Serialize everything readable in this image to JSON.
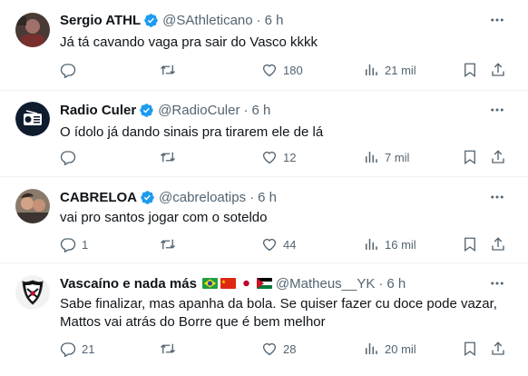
{
  "tweets": [
    {
      "name": "Sergio ATHL",
      "handle": "@SAthleticano",
      "time": "6 h",
      "text": "Já tá cavando vaga pra sair do Vasco kkkk",
      "replies": "",
      "retweets": "",
      "likes": "180",
      "views": "21 mil",
      "avatar_icon": "photo-avatar"
    },
    {
      "name": "Radio Culer",
      "handle": "@RadioCuler",
      "time": "6 h",
      "text": "O ídolo já dando sinais pra tirarem ele de lá",
      "replies": "",
      "retweets": "",
      "likes": "12",
      "views": "7 mil",
      "avatar_icon": "radio-icon"
    },
    {
      "name": "CABRELOA",
      "handle": "@cabreloatips",
      "time": "6 h",
      "text": "vai pro santos jogar com o soteldo",
      "replies": "1",
      "retweets": "",
      "likes": "44",
      "views": "16 mil",
      "avatar_icon": "photo-avatar"
    },
    {
      "name": "Vascaíno e nada más",
      "handle": "@Matheus__YK",
      "time": "6 h",
      "text_line1": "Sabe finalizar, mas apanha da bola. Se quiser fazer cu doce pode vazar,",
      "text_line2": "Mattos vai atrás do Borre que é bem melhor",
      "replies": "21",
      "retweets": "",
      "likes": "28",
      "views": "20 mil",
      "avatar_icon": "vasco-crest-icon",
      "flags": [
        "brazil-flag",
        "china-flag",
        "japan-flag",
        "jordan-flag"
      ]
    }
  ],
  "colors": {
    "text": "#0f1419",
    "secondary": "#536471",
    "verified": "#1d9bf0",
    "divider": "#eff3f4"
  },
  "dot": "·"
}
